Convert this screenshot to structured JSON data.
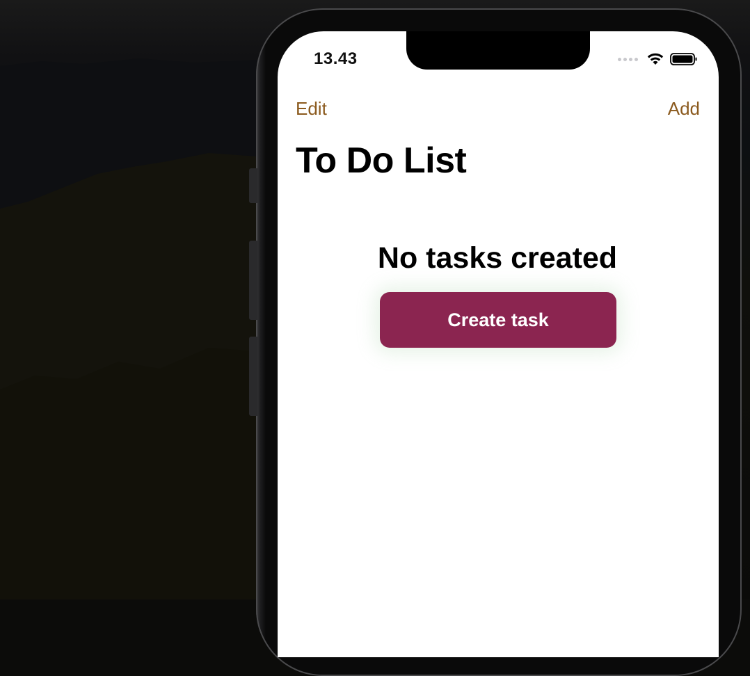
{
  "status_bar": {
    "time": "13.43",
    "signal_icon": "signal-dots-icon",
    "wifi_icon": "wifi-icon",
    "battery_icon": "battery-icon"
  },
  "nav": {
    "edit_label": "Edit",
    "add_label": "Add"
  },
  "page": {
    "title": "To Do List"
  },
  "empty_state": {
    "message": "No tasks created",
    "create_button_label": "Create task"
  },
  "colors": {
    "nav_accent": "#8b5a1e",
    "button_background": "#8b2550",
    "button_text": "#ffffff"
  }
}
